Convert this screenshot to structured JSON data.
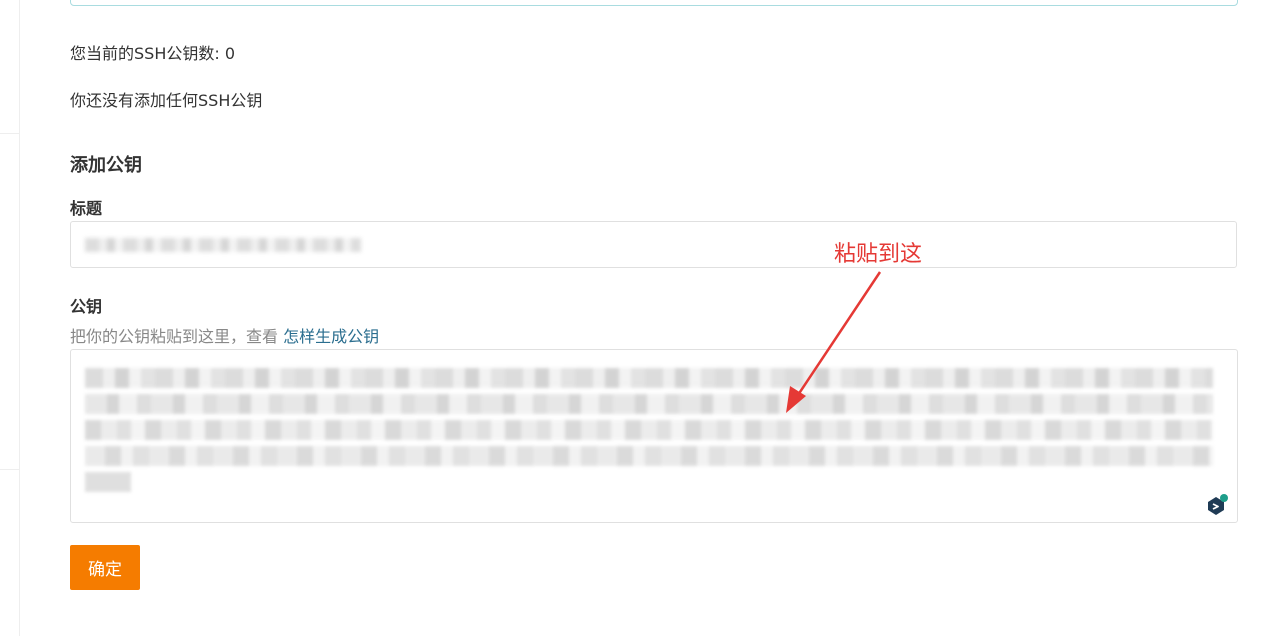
{
  "ssh": {
    "count_text": "您当前的SSH公钥数: 0",
    "empty_text": "你还没有添加任何SSH公钥"
  },
  "add_key": {
    "section_title": "添加公钥",
    "title_label": "标题",
    "key_label": "公钥",
    "hint_text": "把你的公钥粘贴到这里，查看 ",
    "hint_link": "怎样生成公钥",
    "confirm_label": "确定"
  },
  "annotation": {
    "text": "粘贴到这",
    "color": "#e53935"
  },
  "colors": {
    "confirm_button": "#f57c00",
    "link": "#2b6e8f",
    "top_box_border": "#a9dce0"
  },
  "icons": {
    "assistant": "assistant-icon"
  }
}
